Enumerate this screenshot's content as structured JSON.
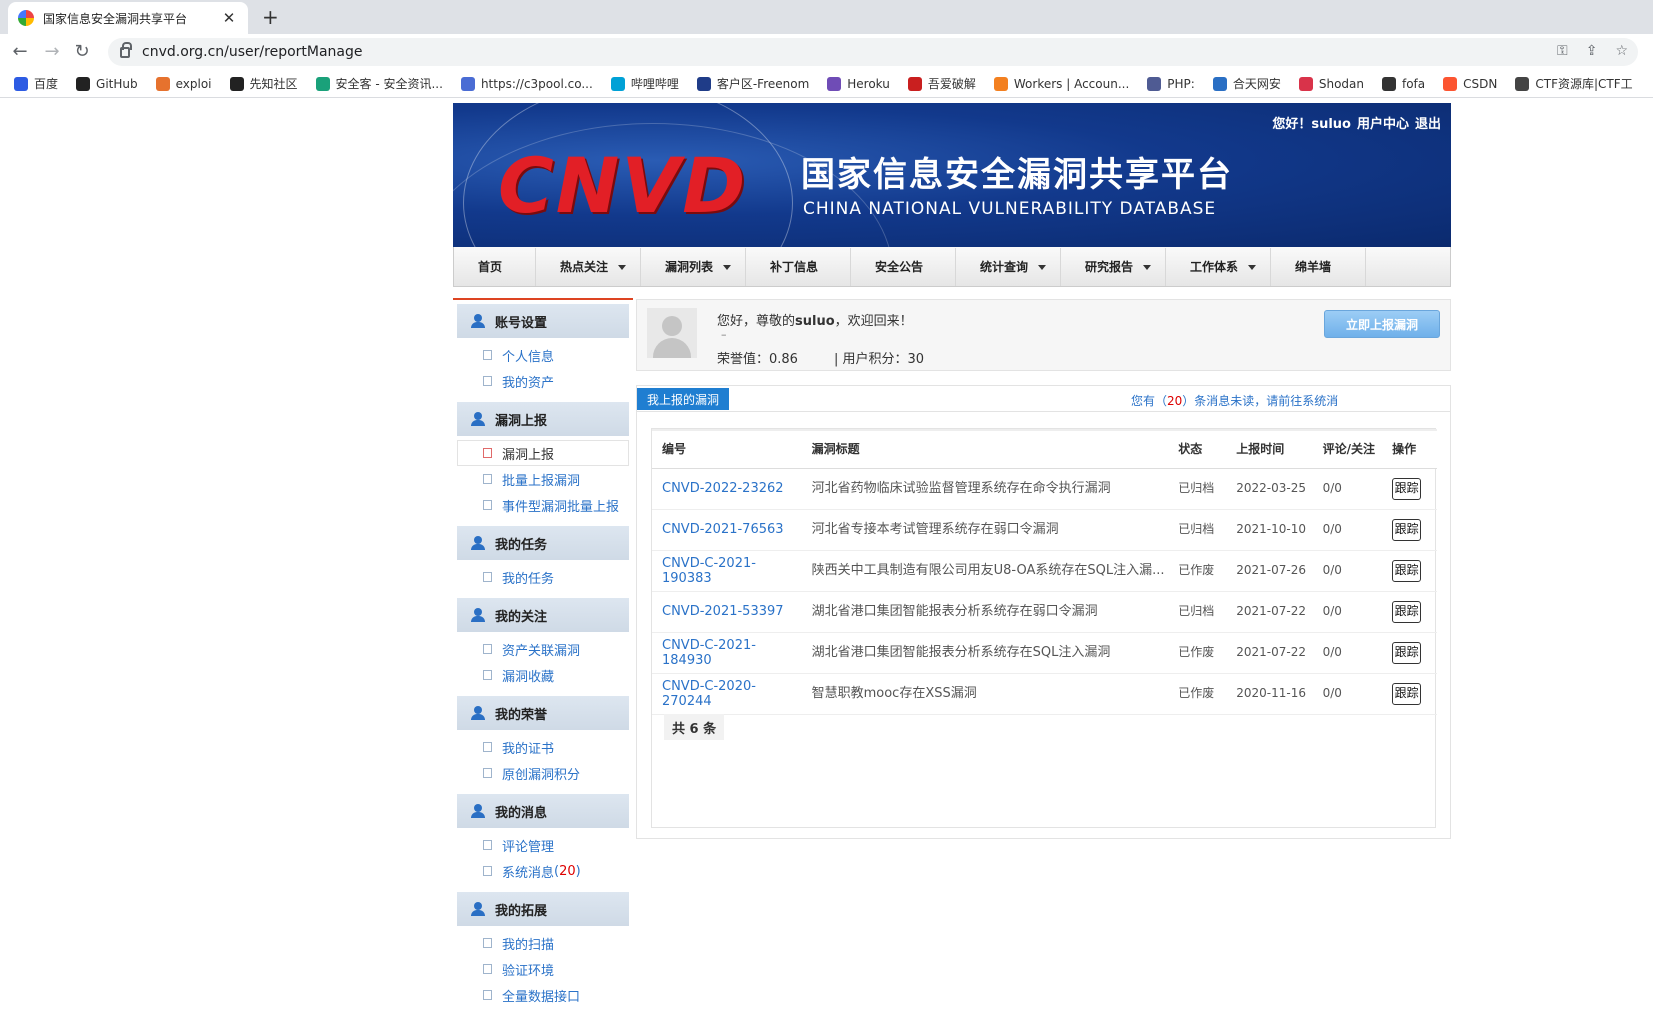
{
  "browser": {
    "tab_title": "国家信息安全漏洞共享平台",
    "url": "cnvd.org.cn/user/reportManage",
    "bookmarks": [
      {
        "label": "百度",
        "color": "#2d5be3"
      },
      {
        "label": "GitHub",
        "color": "#222222"
      },
      {
        "label": "exploi",
        "color": "#e6722e"
      },
      {
        "label": "先知社区",
        "color": "#222222"
      },
      {
        "label": "安全客 - 安全资讯...",
        "color": "#1aa17a"
      },
      {
        "label": "https://c3pool.co...",
        "color": "#4a6cd4"
      },
      {
        "label": "哔哩哔哩",
        "color": "#00a1d6"
      },
      {
        "label": "客户区-Freenom",
        "color": "#1f3c88"
      },
      {
        "label": "Heroku",
        "color": "#6f4cb6"
      },
      {
        "label": "吾爱破解",
        "color": "#c91f1f"
      },
      {
        "label": "Workers | Accoun...",
        "color": "#f38020"
      },
      {
        "label": "PHP:",
        "color": "#4f5b93"
      },
      {
        "label": "合天网安",
        "color": "#2a6fc4"
      },
      {
        "label": "Shodan",
        "color": "#d9334a"
      },
      {
        "label": "fofa",
        "color": "#333333"
      },
      {
        "label": "CSDN",
        "color": "#fc5531"
      },
      {
        "label": "CTF资源库|CTF工",
        "color": "#444444"
      }
    ]
  },
  "header": {
    "logo": "CNVD",
    "title_cn": "国家信息安全漏洞共享平台",
    "title_en": "CHINA NATIONAL VULNERABILITY DATABASE",
    "greeting": "您好！suluo",
    "user_center": "用户中心",
    "logout": "退出"
  },
  "nav": [
    {
      "label": "首页",
      "dropdown": false
    },
    {
      "label": "热点关注",
      "dropdown": true
    },
    {
      "label": "漏洞列表",
      "dropdown": true
    },
    {
      "label": "补丁信息",
      "dropdown": false
    },
    {
      "label": "安全公告",
      "dropdown": false
    },
    {
      "label": "统计查询",
      "dropdown": true
    },
    {
      "label": "研究报告",
      "dropdown": true
    },
    {
      "label": "工作体系",
      "dropdown": true
    },
    {
      "label": "绵羊墙",
      "dropdown": false
    }
  ],
  "sidebar": [
    {
      "title": "账号设置",
      "items": [
        "个人信息",
        "我的资产"
      ]
    },
    {
      "title": "漏洞上报",
      "items": [
        "漏洞上报",
        "批量上报漏洞",
        "事件型漏洞批量上报"
      ]
    },
    {
      "title": "我的任务",
      "items": [
        "我的任务"
      ]
    },
    {
      "title": "我的关注",
      "items": [
        "资产关联漏洞",
        "漏洞收藏"
      ]
    },
    {
      "title": "我的荣誉",
      "items": [
        "我的证书",
        "原创漏洞积分"
      ]
    },
    {
      "title": "我的消息",
      "items": [
        "评论管理",
        "系统消息"
      ]
    },
    {
      "title": "我的拓展",
      "items": [
        "我的扫描",
        "验证环境",
        "全量数据接口"
      ]
    }
  ],
  "sidebar_extra": {
    "unread_prefix": "( ",
    "unread_count": "20",
    "unread_suffix": " )"
  },
  "profile": {
    "greet_prefix": "您好，尊敬的",
    "username": "suluo",
    "greet_suffix": "，欢迎回来！",
    "dash": "–",
    "honor": "荣誉值：0.86",
    "points": "| 用户积分：30",
    "report_button": "立即上报漏洞"
  },
  "panel": {
    "tab": "我上报的漏洞",
    "msg_prefix": "您有（",
    "msg_count": "20",
    "msg_suffix": "）条消息未读，请前往系统消",
    "columns": [
      "编号",
      "漏洞标题",
      "状态",
      "上报时间",
      "评论/关注",
      "操作"
    ],
    "rows": [
      {
        "id": "CNVD-2022-23262",
        "title": "河北省药物临床试验监督管理系统存在命令执行漏洞",
        "status": "已归档",
        "date": "2022-03-25",
        "comments": "0/0",
        "action": "跟踪"
      },
      {
        "id": "CNVD-2021-76563",
        "title": "河北省专接本考试管理系统存在弱口令漏洞",
        "status": "已归档",
        "date": "2021-10-10",
        "comments": "0/0",
        "action": "跟踪"
      },
      {
        "id": "CNVD-C-2021-190383",
        "title": "陕西关中工具制造有限公司用友U8-OA系统存在SQL注入漏...",
        "status": "已作废",
        "date": "2021-07-26",
        "comments": "0/0",
        "action": "跟踪"
      },
      {
        "id": "CNVD-2021-53397",
        "title": "湖北省港口集团智能报表分析系统存在弱口令漏洞",
        "status": "已归档",
        "date": "2021-07-22",
        "comments": "0/0",
        "action": "跟踪"
      },
      {
        "id": "CNVD-C-2021-184930",
        "title": "湖北省港口集团智能报表分析系统存在SQL注入漏洞",
        "status": "已作废",
        "date": "2021-07-22",
        "comments": "0/0",
        "action": "跟踪"
      },
      {
        "id": "CNVD-C-2020-270244",
        "title": "智慧职教mooc存在XSS漏洞",
        "status": "已作废",
        "date": "2020-11-16",
        "comments": "0/0",
        "action": "跟踪"
      }
    ],
    "total": "共 6 条"
  }
}
